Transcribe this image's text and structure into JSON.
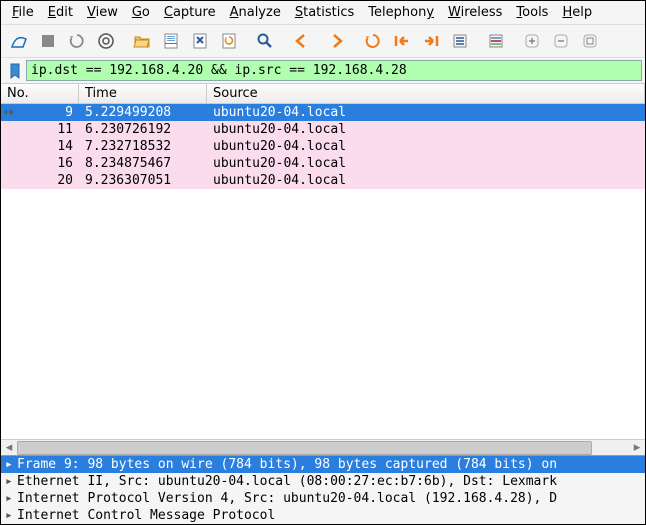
{
  "menus": [
    {
      "ul": "F",
      "rest": "ile"
    },
    {
      "ul": "E",
      "rest": "dit"
    },
    {
      "ul": "V",
      "rest": "iew"
    },
    {
      "ul": "G",
      "rest": "o"
    },
    {
      "ul": "C",
      "rest": "apture"
    },
    {
      "ul": "A",
      "rest": "nalyze"
    },
    {
      "ul": "S",
      "rest": "tatistics"
    },
    {
      "ul": "T",
      "rest": "elephon",
      "ul2": "y"
    },
    {
      "ul": "W",
      "rest": "ireless"
    },
    {
      "ul": "T",
      "rest": "ools"
    },
    {
      "ul": "H",
      "rest": "elp"
    }
  ],
  "filter": "ip.dst == 192.168.4.20 && ip.src == 192.168.4.28",
  "columns": {
    "no": "No.",
    "time": "Time",
    "source": "Source"
  },
  "packets": [
    {
      "no": "9",
      "time": "5.229499208",
      "source": "ubuntu20-04.local",
      "sel": true
    },
    {
      "no": "11",
      "time": "6.230726192",
      "source": "ubuntu20-04.local"
    },
    {
      "no": "14",
      "time": "7.232718532",
      "source": "ubuntu20-04.local"
    },
    {
      "no": "16",
      "time": "8.234875467",
      "source": "ubuntu20-04.local"
    },
    {
      "no": "20",
      "time": "9.236307051",
      "source": "ubuntu20-04.local"
    }
  ],
  "details": [
    {
      "text": "Frame 9: 98 bytes on wire (784 bits), 98 bytes captured (784 bits) on",
      "sel": true
    },
    {
      "text": "Ethernet II, Src: ubuntu20-04.local (08:00:27:ec:b7:6b), Dst: Lexmark"
    },
    {
      "text": "Internet Protocol Version 4, Src: ubuntu20-04.local (192.168.4.28), D"
    },
    {
      "text": "Internet Control Message Protocol"
    }
  ]
}
